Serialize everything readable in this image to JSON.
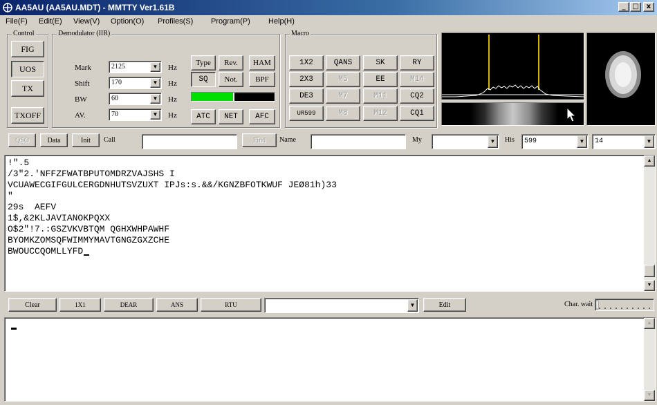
{
  "window": {
    "title": "AA5AU (AA5AU.MDT) - MMTTY Ver1.61B",
    "minimize": "_",
    "restore": "□",
    "close": "x"
  },
  "menu": [
    "File(F)",
    "Edit(E)",
    "View(V)",
    "Option(O)",
    "Profiles(S)",
    "Program(P)",
    "Help(H)"
  ],
  "control": {
    "label": "Control",
    "buttons": [
      "FIG",
      "UOS",
      "TX",
      "TXOFF"
    ]
  },
  "demod": {
    "label": "Demodulator (IIR)",
    "rows": [
      {
        "label": "Mark",
        "value": "2125",
        "unit": "Hz"
      },
      {
        "label": "Shift",
        "value": "170",
        "unit": "Hz"
      },
      {
        "label": "BW",
        "value": "60",
        "unit": "Hz"
      },
      {
        "label": "AV.",
        "value": "70",
        "unit": "Hz"
      }
    ],
    "buttons": {
      "type": "Type",
      "rev": "Rev.",
      "ham": "HAM",
      "sq": "SQ",
      "not": "Not.",
      "bpf": "BPF",
      "atc": "ATC",
      "net": "NET",
      "afc": "AFC"
    },
    "squelch_level": 0.5
  },
  "macro": {
    "label": "Macro",
    "buttons": [
      [
        "1X2",
        "QANS",
        "SK",
        "RY"
      ],
      [
        "2X3",
        "M5",
        "EE",
        "M14"
      ],
      [
        "DE3",
        "M7",
        "M11",
        "CQ2"
      ],
      [
        "UR599",
        "M8",
        "M12",
        "CQ1"
      ]
    ],
    "disabled": [
      "M5",
      "M14",
      "M7",
      "M11",
      "M8",
      "M12"
    ]
  },
  "log": {
    "qso": "QSO",
    "data": "Data",
    "init": "Init",
    "call_label": "Call",
    "call_value": "",
    "find": "Find",
    "name_label": "Name",
    "name_value": "",
    "my_label": "My",
    "my_value": "",
    "his_label": "His",
    "his_value": "599",
    "extra_value": "14"
  },
  "rx": {
    "lines": [
      "!\".5",
      "/3\"2.'NFFZFWATBPUTOMDRZVAJSHS I",
      "VCUAWECGIFGULCERGDNHUTSVZUXT IPJs:s.&&/KGNZBFOTKWUF JEØ81h)33",
      "\"",
      "29s  AEFV",
      "1$,&2KLJAVIANOKPQXX",
      "O$2\"!7.:GSZVKVBTQM QGHXWHPAWHF",
      "BYOMKZOMSQFWIMMYMAVTGNGZGXZCHE",
      "BWOUCCQOMLLYFD"
    ]
  },
  "txbar": {
    "clear": "Clear",
    "b1": "1X1",
    "b2": "DEAR",
    "b3": "ANS",
    "b4": "RTU",
    "combo_value": "",
    "edit": "Edit",
    "charwait_label": "Char. wait"
  },
  "tx": {
    "text": ""
  },
  "colors": {
    "titlebar_start": "#0a246a",
    "titlebar_end": "#a6caf0",
    "squelch_green": "#00e000",
    "tuning_marker": "#d4b400"
  }
}
